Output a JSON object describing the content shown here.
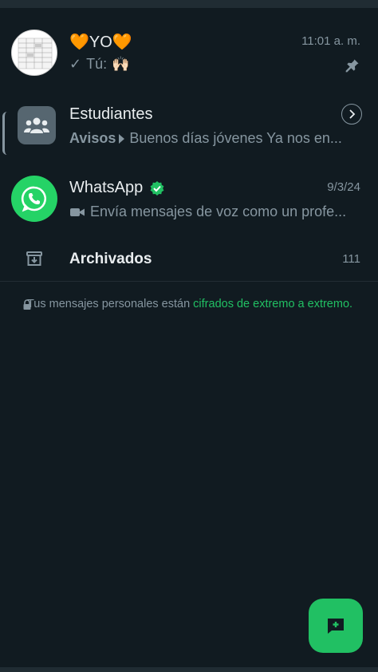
{
  "chats": [
    {
      "name": "🧡YO🧡",
      "time": "11:01 a. m.",
      "preview_sender": "Tú:",
      "preview_text": "🙌🏻",
      "pinned": true
    },
    {
      "name": "Estudiantes",
      "preview_group": "Avisos",
      "preview_text": "Buenos días jóvenes   Ya nos en...",
      "type": "community"
    },
    {
      "name": "WhatsApp",
      "time": "9/3/24",
      "preview_text": "Envía mensajes de voz como un profe...",
      "verified": true
    }
  ],
  "archived": {
    "label": "Archivados",
    "count": "111"
  },
  "encryption": {
    "text": "Tus mensajes personales están ",
    "link": "cifrados de extremo a extremo",
    "end": "."
  },
  "colors": {
    "background": "#111b21",
    "accent": "#21c063",
    "text_secondary": "#8696a0"
  },
  "icons": {
    "pin": "pin-icon",
    "check": "check-icon",
    "community": "community-icon",
    "verified": "verified-badge-icon",
    "video": "video-camera-icon",
    "archive": "archive-icon",
    "lock": "lock-icon",
    "new_chat": "new-chat-icon"
  }
}
